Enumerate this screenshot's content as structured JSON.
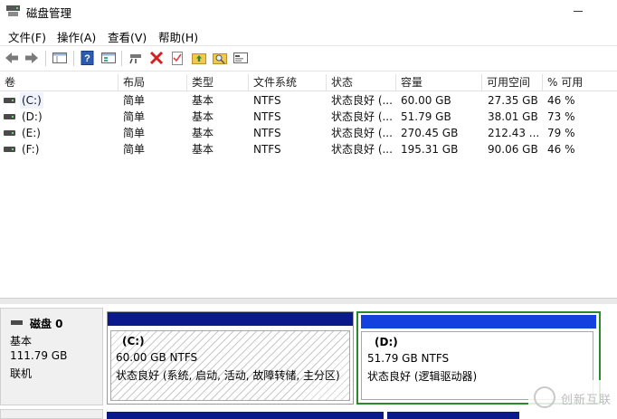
{
  "window": {
    "title": "磁盘管理"
  },
  "menu": [
    "文件(F)",
    "操作(A)",
    "查看(V)",
    "帮助(H)"
  ],
  "toolbar_icons": [
    "back-arrow-icon",
    "forward-arrow-icon",
    "properties-view-icon",
    "help-icon",
    "list-view-icon",
    "connect-disk-icon",
    "delete-icon",
    "check-icon",
    "folder-up-icon",
    "folder-search-icon",
    "console-icon"
  ],
  "columns": [
    "卷",
    "布局",
    "类型",
    "文件系统",
    "状态",
    "容量",
    "可用空间",
    "% 可用"
  ],
  "volumes": [
    {
      "name": "(C:)",
      "layout": "简单",
      "type": "基本",
      "fs": "NTFS",
      "status": "状态良好 (...",
      "capacity": "60.00 GB",
      "free": "27.35 GB",
      "pct": "46 %"
    },
    {
      "name": "(D:)",
      "layout": "简单",
      "type": "基本",
      "fs": "NTFS",
      "status": "状态良好 (...",
      "capacity": "51.79 GB",
      "free": "38.01 GB",
      "pct": "73 %"
    },
    {
      "name": "(E:)",
      "layout": "简单",
      "type": "基本",
      "fs": "NTFS",
      "status": "状态良好 (...",
      "capacity": "270.45 GB",
      "free": "212.43 ...",
      "pct": "79 %"
    },
    {
      "name": "(F:)",
      "layout": "简单",
      "type": "基本",
      "fs": "NTFS",
      "status": "状态良好 (...",
      "capacity": "195.31 GB",
      "free": "90.06 GB",
      "pct": "46 %"
    }
  ],
  "disk0": {
    "name": "磁盘 0",
    "type": "基本",
    "size": "111.79 GB",
    "state": "联机",
    "partitions": [
      {
        "name": "(C:)",
        "size": "60.00 GB NTFS",
        "status": "状态良好 (系统, 启动, 活动, 故障转储, 主分区)"
      },
      {
        "name": "(D:)",
        "size": "51.79 GB NTFS",
        "status": "状态良好 (逻辑驱动器)"
      }
    ]
  },
  "watermark": {
    "text": "创新互联"
  },
  "colors": {
    "primary_bar": "#0a1a8a",
    "logical_bar": "#1540e0",
    "logical_border": "#2a8a2a"
  }
}
